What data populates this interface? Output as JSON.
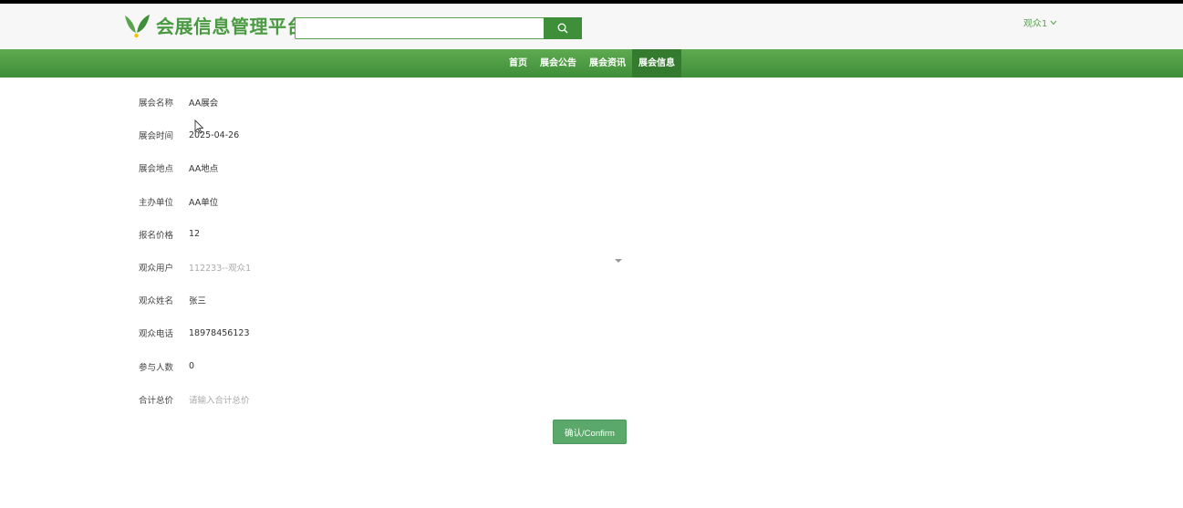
{
  "brand": {
    "title": "会展信息管理平台",
    "accent": "#4a9a41"
  },
  "header": {
    "search_placeholder": "",
    "search_icon": "search-icon",
    "user_label": "观众1",
    "user_caret": "chevron-down-icon"
  },
  "nav": {
    "items": [
      {
        "label": "首页",
        "active": false
      },
      {
        "label": "展会公告",
        "active": false
      },
      {
        "label": "展会资讯",
        "active": false
      },
      {
        "label": "展会信息",
        "active": true
      }
    ]
  },
  "form": {
    "fields": [
      {
        "label": "展会名称",
        "value": "AA展会"
      },
      {
        "label": "展会时间",
        "value": "2025-04-26"
      },
      {
        "label": "展会地点",
        "value": "AA地点"
      },
      {
        "label": "主办单位",
        "value": "AA单位"
      },
      {
        "label": "报名价格",
        "value": "12"
      },
      {
        "label": "观众用户",
        "value": "112233--观众1"
      },
      {
        "label": "观众姓名",
        "value": "张三"
      },
      {
        "label": "观众电话",
        "value": "18978456123"
      },
      {
        "label": "参与人数",
        "value": "0"
      },
      {
        "label": "合计总价",
        "placeholder": "请输入合计总价"
      }
    ],
    "confirm_label": "确认/Confirm"
  }
}
